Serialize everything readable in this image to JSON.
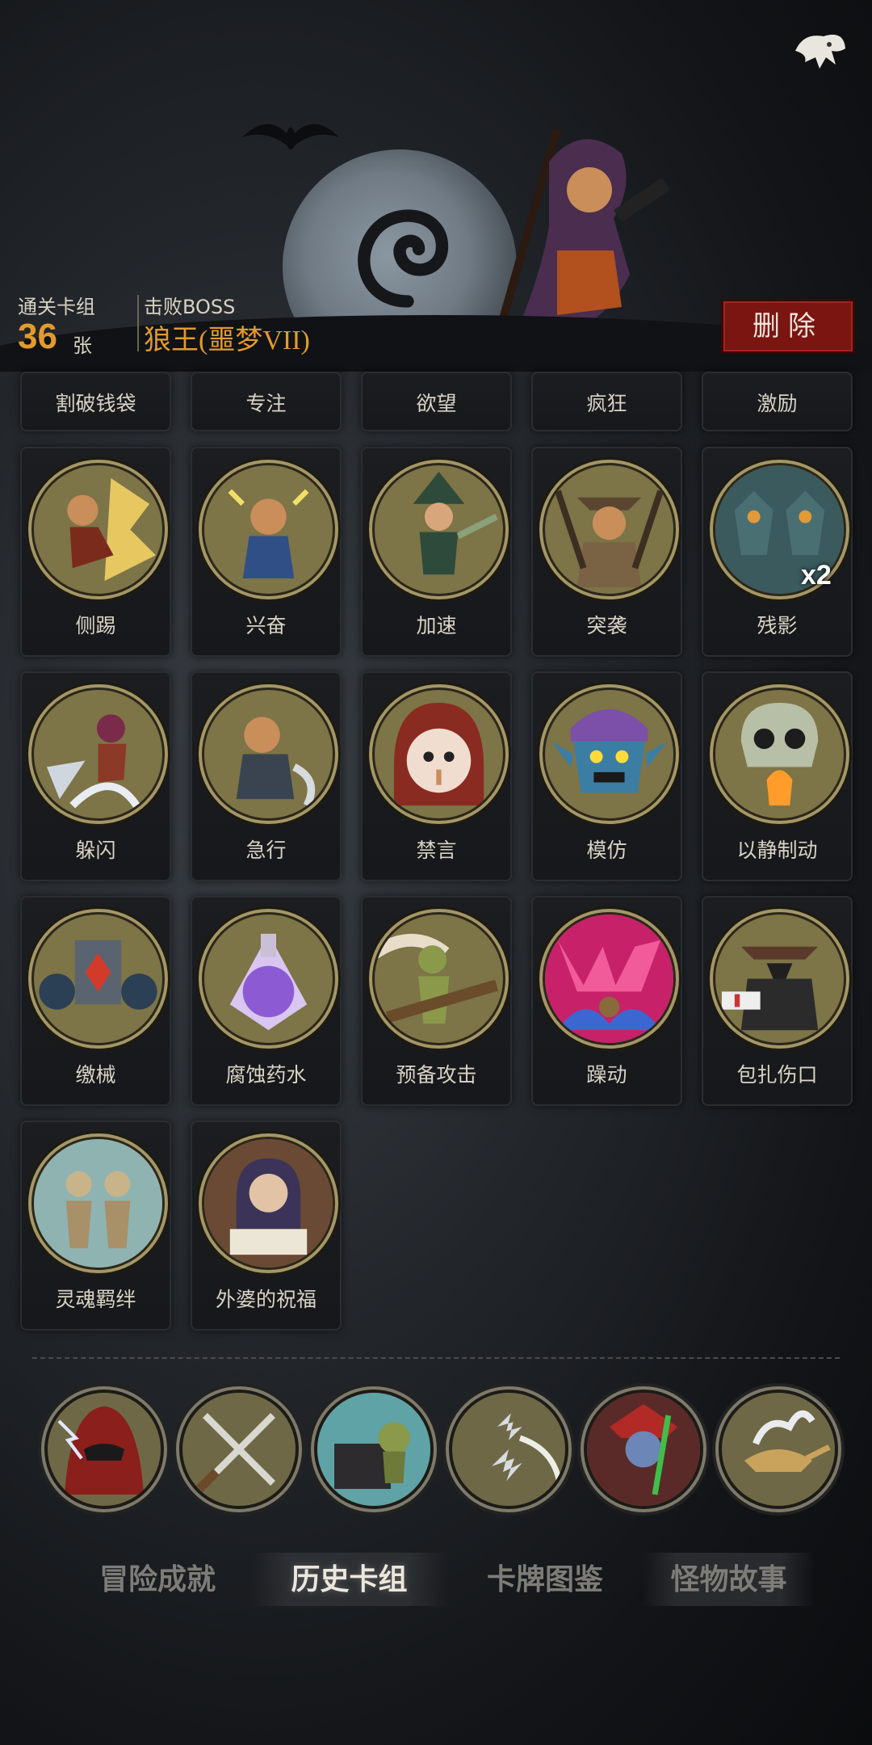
{
  "header": {
    "cleared_label": "通关卡组",
    "card_count": "36",
    "card_unit": "张",
    "boss_label": "击败BOSS",
    "boss_name": "狼王(噩梦VII)",
    "delete_label": "删除"
  },
  "cards": [
    {
      "name": "割破钱袋",
      "icon": "cut-purse-icon"
    },
    {
      "name": "专注",
      "icon": "focus-icon"
    },
    {
      "name": "欲望",
      "icon": "desire-icon"
    },
    {
      "name": "疯狂",
      "icon": "madness-icon"
    },
    {
      "name": "激励",
      "icon": "inspire-icon"
    },
    {
      "name": "侧踢",
      "icon": "side-kick-icon"
    },
    {
      "name": "兴奋",
      "icon": "excitement-icon"
    },
    {
      "name": "加速",
      "icon": "haste-icon"
    },
    {
      "name": "突袭",
      "icon": "assault-icon"
    },
    {
      "name": "残影",
      "icon": "afterimage-icon",
      "multiplier": "x2"
    },
    {
      "name": "躲闪",
      "icon": "dodge-icon"
    },
    {
      "name": "急行",
      "icon": "dash-icon"
    },
    {
      "name": "禁言",
      "icon": "silence-icon"
    },
    {
      "name": "模仿",
      "icon": "imitate-icon"
    },
    {
      "name": "以静制动",
      "icon": "stillness-icon"
    },
    {
      "name": "缴械",
      "icon": "disarm-icon"
    },
    {
      "name": "腐蚀药水",
      "icon": "corrosive-potion-icon"
    },
    {
      "name": "预备攻击",
      "icon": "ready-attack-icon"
    },
    {
      "name": "躁动",
      "icon": "restless-icon"
    },
    {
      "name": "包扎伤口",
      "icon": "bandage-icon"
    },
    {
      "name": "灵魂羁绊",
      "icon": "soul-bond-icon"
    },
    {
      "name": "外婆的祝福",
      "icon": "grandma-blessing-icon"
    }
  ],
  "relics": [
    {
      "icon": "hooded-lightning-icon"
    },
    {
      "icon": "crossed-daggers-icon"
    },
    {
      "icon": "treasure-chest-icon"
    },
    {
      "icon": "shuriken-icon"
    },
    {
      "icon": "jester-puppet-icon"
    },
    {
      "icon": "magic-lamp-icon"
    }
  ],
  "tabs": [
    {
      "label": "冒险成就",
      "active": false
    },
    {
      "label": "历史卡组",
      "active": true
    },
    {
      "label": "卡牌图鉴",
      "active": false
    },
    {
      "label": "怪物故事",
      "active": false
    }
  ],
  "colors": {
    "accent_orange": "#e39a2d",
    "delete_red": "#7a1512",
    "card_bg": "#1b1d20",
    "frame_gold": "#a49766"
  }
}
